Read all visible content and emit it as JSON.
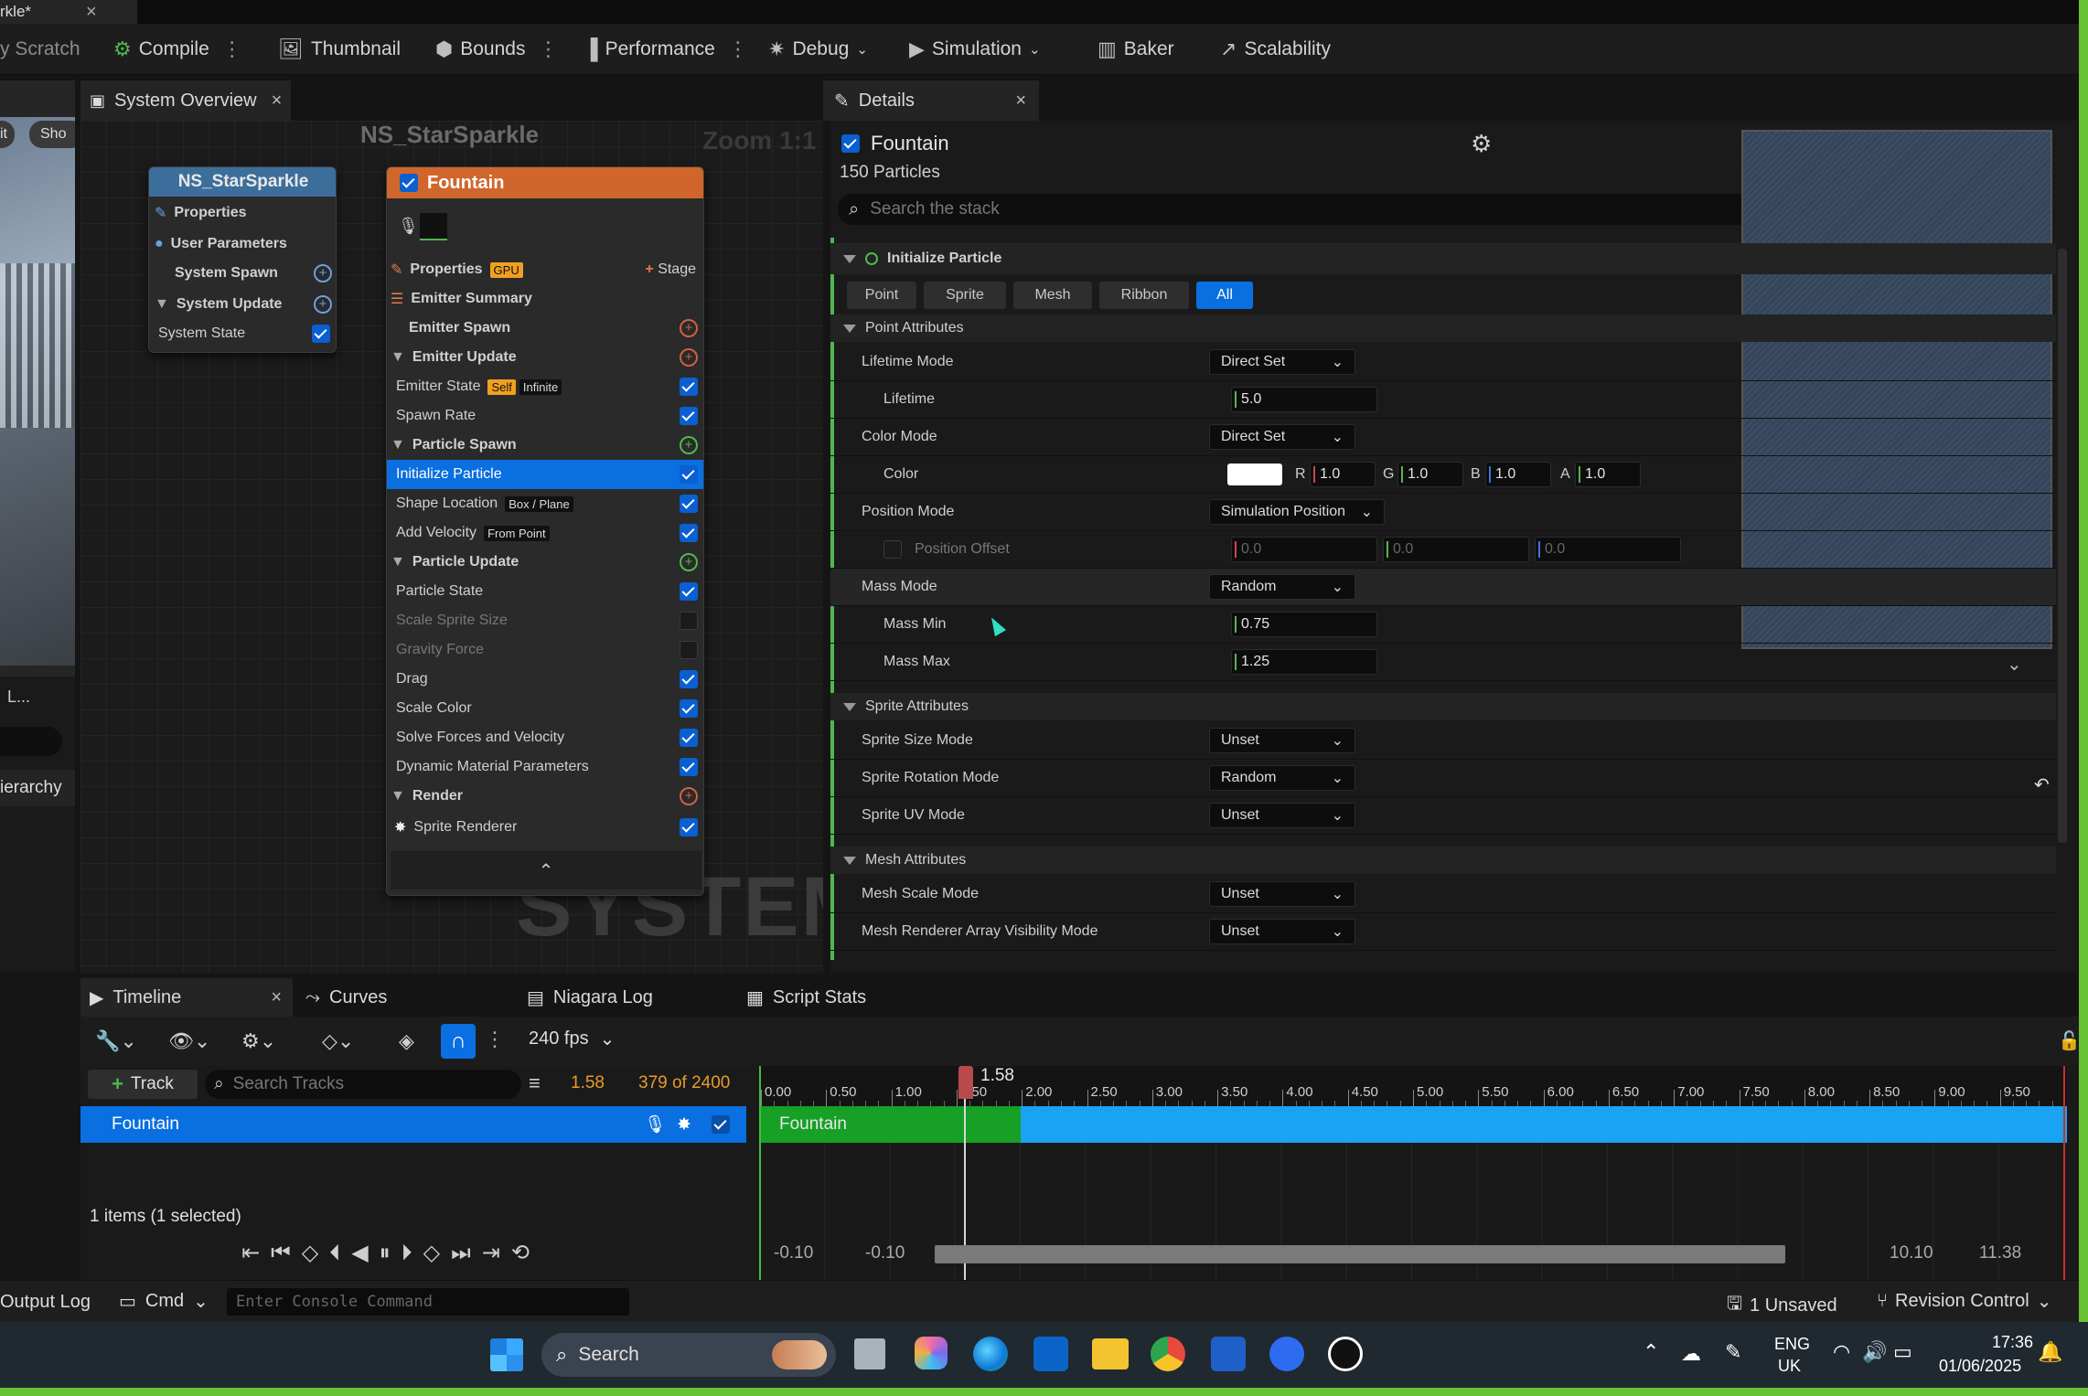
{
  "window": {
    "asset_tab": "rkle*",
    "close": "×"
  },
  "toolbar": {
    "scratch": "y Scratch",
    "compile": "Compile",
    "thumbnail": "Thumbnail",
    "bounds": "Bounds",
    "performance": "Performance",
    "debug": "Debug",
    "simulation": "Simulation",
    "baker": "Baker",
    "scalability": "Scalability"
  },
  "left_strip": {
    "btn1": "it",
    "btn2": "Sho",
    "label": "L...",
    "hierarchy": "ierarchy"
  },
  "system_overview": {
    "tab": "System Overview",
    "graph_title": "NS_StarSparkle",
    "zoom": "Zoom 1:1",
    "watermark": "SYSTEM",
    "system_node": {
      "title": "NS_StarSparkle",
      "rows": [
        "Properties",
        "User Parameters",
        "System Spawn",
        "System Update",
        "System State"
      ]
    },
    "emitter_node": {
      "title": "Fountain",
      "properties": "Properties",
      "gpu": "GPU",
      "stage": "Stage",
      "emitter_summary": "Emitter Summary",
      "emitter_spawn": "Emitter Spawn",
      "emitter_update": "Emitter Update",
      "emitter_state": "Emitter State",
      "self": "Self",
      "infinite": "Infinite",
      "spawn_rate": "Spawn Rate",
      "particle_spawn": "Particle Spawn",
      "initialize_particle": "Initialize Particle",
      "shape_location": "Shape Location",
      "box_plane": "Box / Plane",
      "add_velocity": "Add Velocity",
      "from_point": "From Point",
      "particle_update": "Particle Update",
      "particle_state": "Particle State",
      "scale_sprite_size": "Scale Sprite Size",
      "gravity_force": "Gravity Force",
      "drag": "Drag",
      "scale_color": "Scale Color",
      "solve_forces": "Solve Forces and Velocity",
      "dynamic_material": "Dynamic Material Parameters",
      "render": "Render",
      "sprite_renderer": "Sprite Renderer"
    }
  },
  "details": {
    "tab": "Details",
    "emitter_name": "Fountain",
    "particles": "150 Particles",
    "search_placeholder": "Search the stack",
    "module": "Initialize Particle",
    "filters": [
      "Point",
      "Sprite",
      "Mesh",
      "Ribbon",
      "All"
    ],
    "point_attributes": "Point Attributes",
    "lifetime_mode_label": "Lifetime Mode",
    "lifetime_mode": "Direct Set",
    "lifetime_label": "Lifetime",
    "lifetime": "5.0",
    "color_mode_label": "Color Mode",
    "color_mode": "Direct Set",
    "color_label": "Color",
    "color_r_label": "R",
    "color_r": "1.0",
    "color_g_label": "G",
    "color_g": "1.0",
    "color_b_label": "B",
    "color_b": "1.0",
    "color_a_label": "A",
    "color_a": "1.0",
    "position_mode_label": "Position Mode",
    "position_mode": "Simulation Position",
    "position_offset_label": "Position Offset",
    "pos_x": "0.0",
    "pos_y": "0.0",
    "pos_z": "0.0",
    "mass_mode_label": "Mass Mode",
    "mass_mode": "Random",
    "mass_min_label": "Mass Min",
    "mass_min": "0.75",
    "mass_max_label": "Mass Max",
    "mass_max": "1.25",
    "sprite_attributes": "Sprite Attributes",
    "sprite_size_mode_label": "Sprite Size Mode",
    "sprite_size_mode": "Unset",
    "sprite_rotation_mode_label": "Sprite Rotation Mode",
    "sprite_rotation_mode": "Random",
    "sprite_uv_mode_label": "Sprite UV Mode",
    "sprite_uv_mode": "Unset",
    "mesh_attributes": "Mesh Attributes",
    "mesh_scale_mode_label": "Mesh Scale Mode",
    "mesh_scale_mode": "Unset",
    "mesh_vis_label": "Mesh Renderer Array Visibility Mode",
    "mesh_vis": "Unset"
  },
  "timeline": {
    "tabs": [
      "Timeline",
      "Curves",
      "Niagara Log",
      "Script Stats"
    ],
    "fps": "240 fps",
    "track_button": "Track",
    "search_placeholder": "Search Tracks",
    "time": "1.58",
    "frame": "379 of 2400",
    "playhead": "1.58",
    "track_name": "Fountain",
    "bar_label": "Fountain",
    "ticks": [
      "0.00",
      "0.50",
      "1.00",
      "1.50",
      "2.00",
      "2.50",
      "3.00",
      "3.50",
      "4.00",
      "4.50",
      "5.00",
      "5.50",
      "6.00",
      "6.50",
      "7.00",
      "7.50",
      "8.00",
      "8.50",
      "9.00",
      "9.50"
    ],
    "items": "1 items (1 selected)",
    "range_start_a": "-0.10",
    "range_start_b": "-0.10",
    "range_end_a": "10.10",
    "range_end_b": "11.38"
  },
  "status_bar": {
    "output_log": "Output Log",
    "cmd": "Cmd",
    "console_placeholder": "Enter Console Command",
    "unsaved": "1 Unsaved",
    "revision": "Revision Control"
  },
  "taskbar": {
    "search": "Search",
    "lang1": "ENG",
    "lang2": "UK",
    "time": "17:36",
    "date": "01/06/2025"
  },
  "colors": {
    "accent": "#0a6fe0",
    "green_track": "#16a026",
    "blue_track": "#1aa3f2",
    "frame_green": "#68c232"
  }
}
